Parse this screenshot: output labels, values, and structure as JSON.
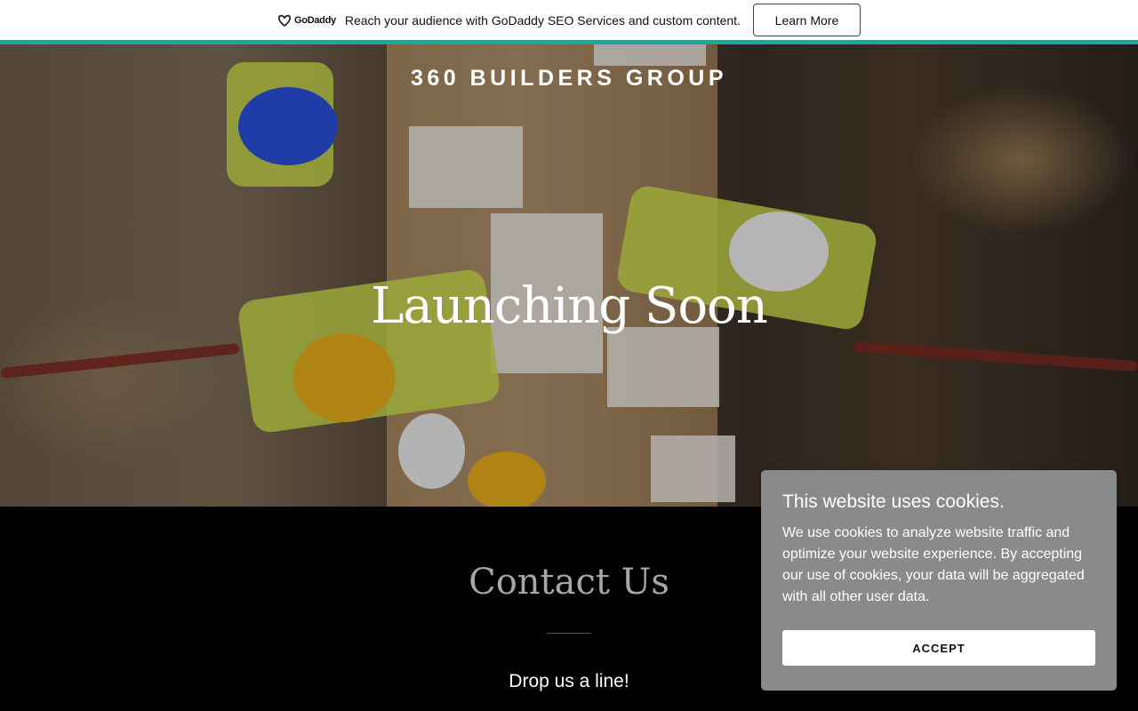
{
  "promo": {
    "logo_text": "GoDaddy",
    "message": "Reach your audience with GoDaddy SEO Services and custom content.",
    "cta_label": "Learn More",
    "accent_color": "#1ba8a0"
  },
  "hero": {
    "brand": "360 BUILDERS GROUP",
    "headline": "Launching Soon"
  },
  "contact": {
    "title": "Contact Us",
    "subtitle": "Drop us a line!"
  },
  "cookie": {
    "title": "This website uses cookies.",
    "body": "We use cookies to analyze website traffic and optimize your website experience. By accepting our use of cookies, your data will be aggregated with all other user data.",
    "accept_label": "ACCEPT"
  }
}
